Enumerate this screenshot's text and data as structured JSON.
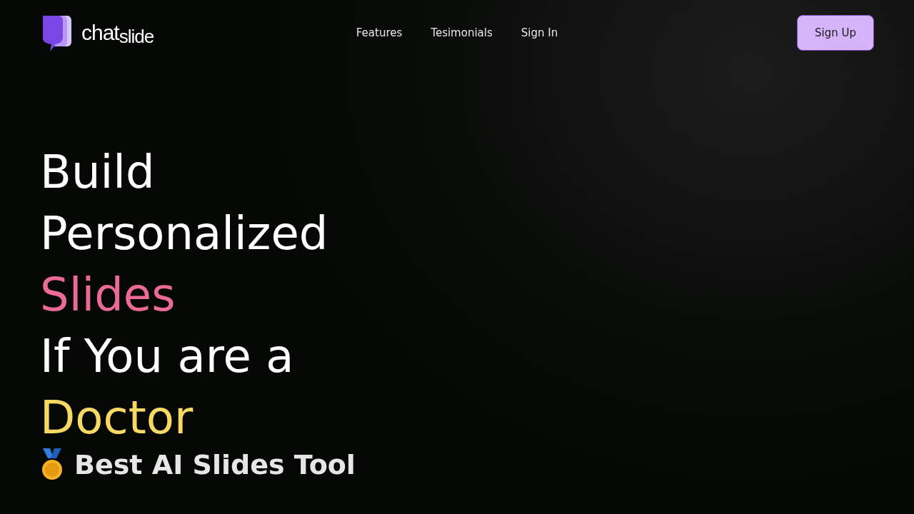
{
  "logo": {
    "word_1": "chat",
    "word_2": "slide"
  },
  "nav": {
    "links": [
      "Features",
      "Tesimonials",
      "Sign In"
    ],
    "button": "Sign Up"
  },
  "headline": [
    {
      "text": "Build",
      "color": "#ffffff"
    },
    {
      "text": "Personalized",
      "color": "#ffffff"
    },
    {
      "text": "Slides",
      "color": "#ec6a96"
    },
    {
      "text": "If You are a",
      "color": "#ffffff"
    },
    {
      "text": "Doctor",
      "color": "#f7d862"
    }
  ],
  "tagline": "Best AI Slides Tool"
}
